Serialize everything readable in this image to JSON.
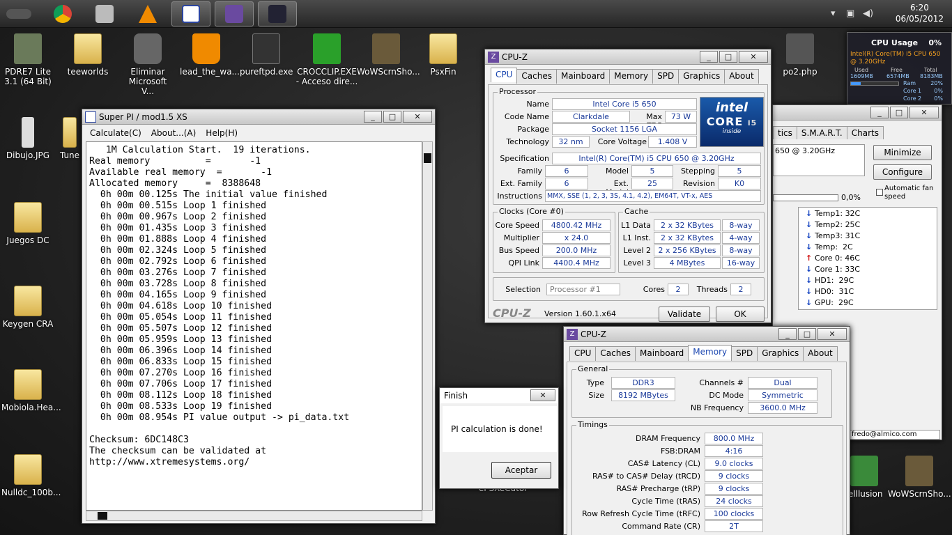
{
  "taskbar": {
    "time": "6:20",
    "date": "06/05/2012"
  },
  "desktop_icons": [
    {
      "label": "PDRE7 Lite 3.1 (64 Bit)",
      "x": 0
    },
    {
      "label": "teeworlds"
    },
    {
      "label": "Eliminar Microsoft V..."
    },
    {
      "label": "lead_the_wa..."
    },
    {
      "label": "pureftpd.exe"
    },
    {
      "label": "CROCCLIP.EXE - Acceso dire..."
    },
    {
      "label": "WoWScrnSho..."
    },
    {
      "label": "PsxFin"
    },
    {
      "label": "po2.php"
    },
    {
      "label": "Dibujo.JPG"
    },
    {
      "label": "Tune"
    },
    {
      "label": "Juegos DC"
    },
    {
      "label": "Keygen CRA"
    },
    {
      "label": "Mobiola.Hea..."
    },
    {
      "label": "Nulldc_100b..."
    },
    {
      "label": "ePSXeCutor"
    },
    {
      "label": "lelllusion"
    },
    {
      "label": "WoWScrnSho..."
    }
  ],
  "superpi": {
    "title": "Super PI / mod1.5 XS",
    "menu": [
      "Calculate(C)",
      "About...(A)",
      "Help(H)"
    ],
    "lines": [
      "   1M Calculation Start.  19 iterations.",
      "Real memory          =       -1",
      "Available real memory  =       -1",
      "Allocated memory     =  8388648",
      "  0h 00m 00.125s The initial value finished",
      "  0h 00m 00.515s Loop 1 finished",
      "  0h 00m 00.967s Loop 2 finished",
      "  0h 00m 01.435s Loop 3 finished",
      "  0h 00m 01.888s Loop 4 finished",
      "  0h 00m 02.324s Loop 5 finished",
      "  0h 00m 02.792s Loop 6 finished",
      "  0h 00m 03.276s Loop 7 finished",
      "  0h 00m 03.728s Loop 8 finished",
      "  0h 00m 04.165s Loop 9 finished",
      "  0h 00m 04.618s Loop 10 finished",
      "  0h 00m 05.054s Loop 11 finished",
      "  0h 00m 05.507s Loop 12 finished",
      "  0h 00m 05.959s Loop 13 finished",
      "  0h 00m 06.396s Loop 14 finished",
      "  0h 00m 06.833s Loop 15 finished",
      "  0h 00m 07.270s Loop 16 finished",
      "  0h 00m 07.706s Loop 17 finished",
      "  0h 00m 08.112s Loop 18 finished",
      "  0h 00m 08.533s Loop 19 finished",
      "  0h 00m 08.954s PI value output -> pi_data.txt",
      "",
      "Checksum: 6DC148C3",
      "The checksum can be validated at",
      "http://www.xtremesystems.org/"
    ]
  },
  "finish": {
    "title": "Finish",
    "message": "PI calculation is done!",
    "ok": "Aceptar"
  },
  "cpuz1": {
    "title": "CPU-Z",
    "tabs": [
      "CPU",
      "Caches",
      "Mainboard",
      "Memory",
      "SPD",
      "Graphics",
      "About"
    ],
    "processor_title": "Processor",
    "name_l": "Name",
    "name": "Intel Core i5 650",
    "code_l": "Code Name",
    "code": "Clarkdale",
    "tdp_l": "Max TDP",
    "tdp": "73 W",
    "pkg_l": "Package",
    "pkg": "Socket 1156 LGA",
    "tech_l": "Technology",
    "tech": "32 nm",
    "volt_l": "Core Voltage",
    "volt": "1.408 V",
    "spec_l": "Specification",
    "spec": "Intel(R) Core(TM) i5 CPU     650  @ 3.20GHz",
    "fam_l": "Family",
    "fam": "6",
    "model_l": "Model",
    "model": "5",
    "step_l": "Stepping",
    "step": "5",
    "efam_l": "Ext. Family",
    "efam": "6",
    "emodel_l": "Ext. Model",
    "emodel": "25",
    "rev_l": "Revision",
    "rev": "K0",
    "inst_l": "Instructions",
    "inst": "MMX, SSE (1, 2, 3, 3S, 4.1, 4.2), EM64T, VT-x, AES",
    "clocks_title": "Clocks (Core #0)",
    "cs_l": "Core Speed",
    "cs": "4800.42 MHz",
    "mul_l": "Multiplier",
    "mul": "x 24.0",
    "bus_l": "Bus Speed",
    "bus": "200.0 MHz",
    "qpi_l": "QPI Link",
    "qpi": "4400.4 MHz",
    "cache_title": "Cache",
    "l1d_l": "L1 Data",
    "l1d": "2 x 32 KBytes",
    "l1d_w": "8-way",
    "l1i_l": "L1 Inst.",
    "l1i": "2 x 32 KBytes",
    "l1i_w": "4-way",
    "l2_l": "Level 2",
    "l2": "2 x 256 KBytes",
    "l2_w": "8-way",
    "l3_l": "Level 3",
    "l3": "4 MBytes",
    "l3_w": "16-way",
    "sel_l": "Selection",
    "sel": "Processor #1",
    "cores_l": "Cores",
    "cores": "2",
    "threads_l": "Threads",
    "threads": "2",
    "brand": "CPU-Z",
    "version": "Version 1.60.1.x64",
    "validate": "Validate",
    "ok": "OK",
    "logo_intel": "intel",
    "logo_core": "CORE",
    "logo_i5": "i5",
    "logo_inside": "inside"
  },
  "cpuz2": {
    "title": "CPU-Z",
    "tabs": [
      "CPU",
      "Caches",
      "Mainboard",
      "Memory",
      "SPD",
      "Graphics",
      "About"
    ],
    "general_title": "General",
    "type_l": "Type",
    "type": "DDR3",
    "ch_l": "Channels #",
    "ch": "Dual",
    "size_l": "Size",
    "size": "8192 MBytes",
    "dc_l": "DC Mode",
    "dc": "Symmetric",
    "nb_l": "NB Frequency",
    "nb": "3600.0 MHz",
    "timings_title": "Timings",
    "timings": [
      {
        "l": "DRAM Frequency",
        "v": "800.0 MHz"
      },
      {
        "l": "FSB:DRAM",
        "v": "4:16"
      },
      {
        "l": "CAS# Latency (CL)",
        "v": "9.0 clocks"
      },
      {
        "l": "RAS# to CAS# Delay (tRCD)",
        "v": "9 clocks"
      },
      {
        "l": "RAS# Precharge (tRP)",
        "v": "9 clocks"
      },
      {
        "l": "Cycle Time (tRAS)",
        "v": "24 clocks"
      },
      {
        "l": "Row Refresh Cycle Time (tRFC)",
        "v": "100 clocks"
      },
      {
        "l": "Command Rate (CR)",
        "v": "2T"
      }
    ]
  },
  "monitor": {
    "tabs": [
      "tics",
      "S.M.A.R.T.",
      "Charts"
    ],
    "cpu": "650 @ 3.20GHz",
    "minimize": "Minimize",
    "configure": "Configure",
    "autofan": "Automatic fan speed",
    "pct": "0,0%",
    "temps": [
      {
        "l": "Temp1: 32C",
        "dir": "down"
      },
      {
        "l": "Temp2: 25C",
        "dir": "down"
      },
      {
        "l": "Temp3: 31C",
        "dir": "down"
      },
      {
        "l": "Temp:  2C",
        "dir": "down"
      },
      {
        "l": "Core 0: 46C",
        "dir": "up"
      },
      {
        "l": "Core 1: 33C",
        "dir": "down"
      },
      {
        "l": "HD1:  29C",
        "dir": "down"
      },
      {
        "l": "HD0:  31C",
        "dir": "down"
      },
      {
        "l": "GPU:  29C",
        "dir": "down"
      }
    ],
    "email": "fredo@almico.com"
  },
  "cpuusage": {
    "title": "CPU Usage",
    "pct": "0%",
    "cpu": "Intel(R) Core(TM) i5 CPU 650 @ 3.20GHz",
    "used_l": "Used",
    "free_l": "Free",
    "total_l": "Total",
    "used": "1609MB",
    "free": "6574MB",
    "total": "8183MB",
    "ram_l": "Ram",
    "ram": "20%",
    "core1_l": "Core 1",
    "core1": "0%",
    "core2_l": "Core 2",
    "core2": "0%"
  }
}
